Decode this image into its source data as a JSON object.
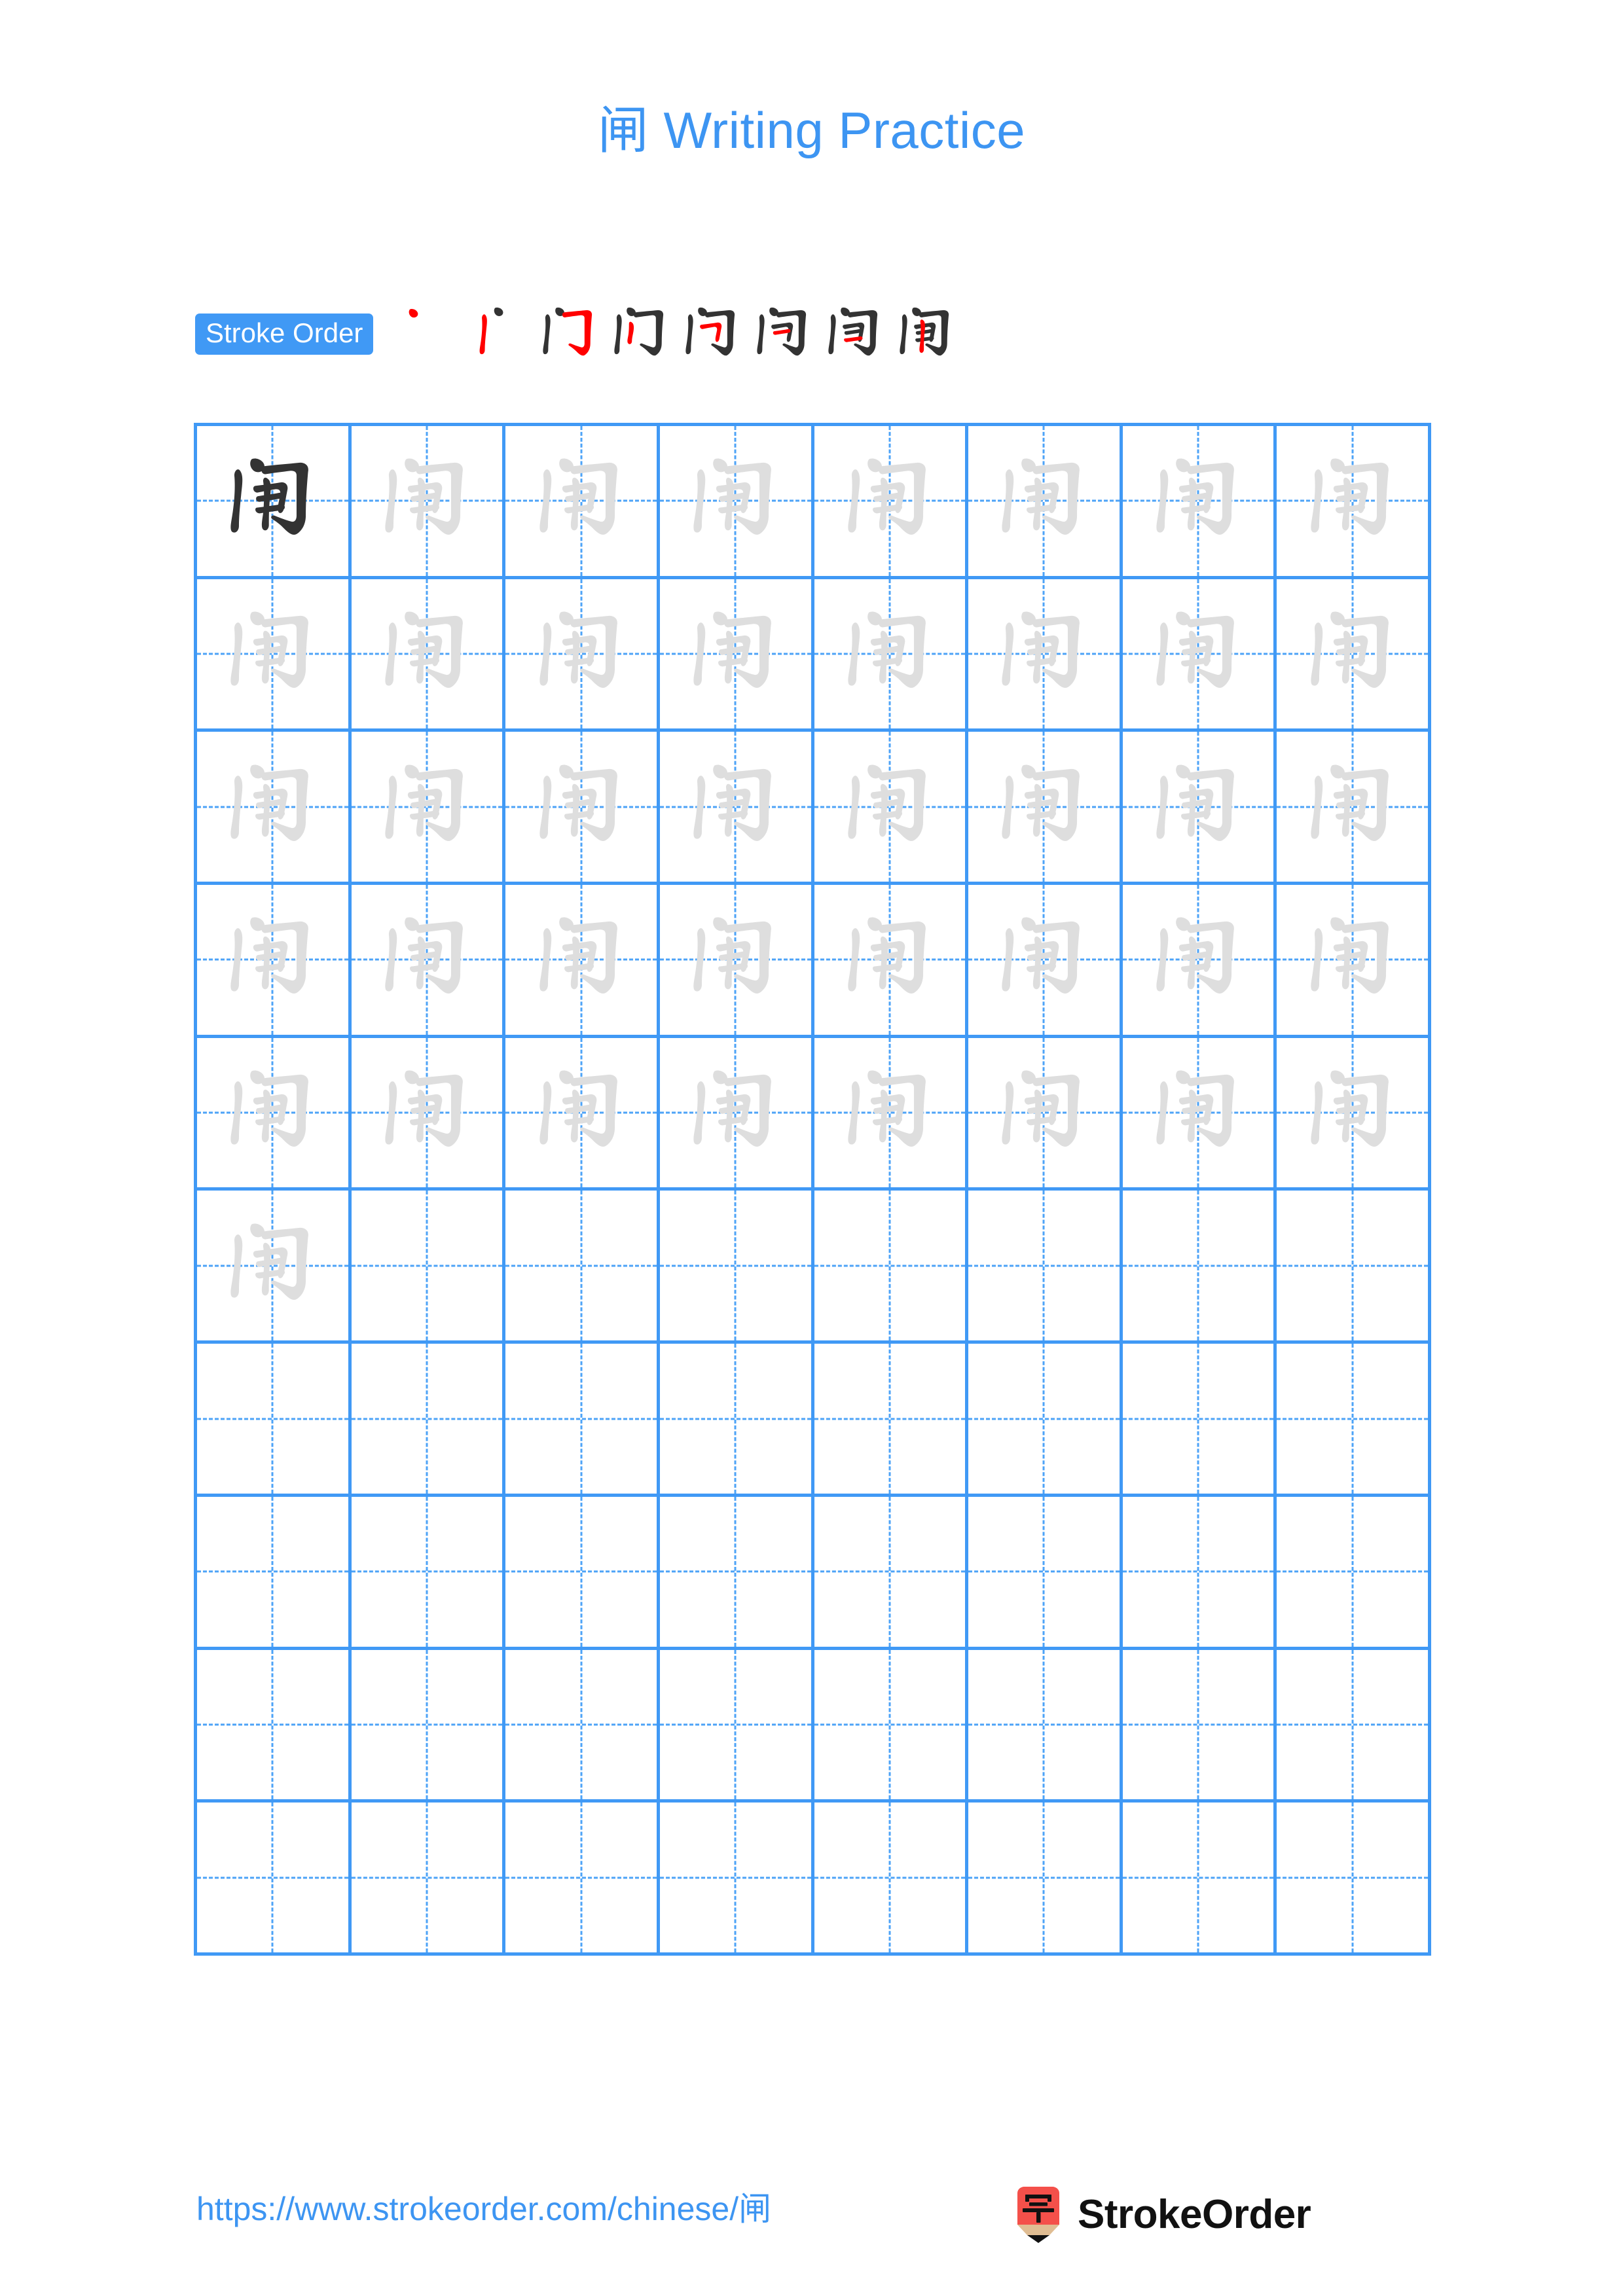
{
  "document": {
    "character": "闸",
    "title_suffix": " Writing Practice",
    "title_full": "闸 Writing Practice",
    "title_color": "#3d95f2",
    "background": "#ffffff"
  },
  "stroke_order": {
    "badge_label": "Stroke Order",
    "badge_bg": "#4099f5",
    "badge_text_color": "#ffffff",
    "new_stroke_color": "#ff0000",
    "done_stroke_color": "#333333",
    "stroke_count": 8,
    "steps": [
      {
        "index": 1,
        "partial": "丶",
        "new_stroke": "dot"
      },
      {
        "index": 2,
        "partial": "丬",
        "new_stroke": "vertical"
      },
      {
        "index": 3,
        "partial": "门",
        "new_stroke": "horizontal-fold-hook"
      },
      {
        "index": 4,
        "partial": "门",
        "new_stroke": "short-vertical"
      },
      {
        "index": 5,
        "partial": "问",
        "new_stroke": "horizontal-fold"
      },
      {
        "index": 6,
        "partial": "问",
        "new_stroke": "horizontal"
      },
      {
        "index": 7,
        "partial": "问",
        "new_stroke": "horizontal"
      },
      {
        "index": 8,
        "partial": "闸",
        "new_stroke": "vertical"
      }
    ]
  },
  "grid": {
    "columns": 8,
    "rows": 10,
    "line_color": "#4099f5",
    "guide_color": "#4da3f7",
    "dark_glyph_color": "#333333",
    "light_glyph_color": "#dedede",
    "dark_cells": 1,
    "traced_cells": 40,
    "blank_cells": 40,
    "cell_character": "闸"
  },
  "footer": {
    "url_text": "https://www.strokeorder.com/chinese/闸",
    "url_color": "#3d95f2",
    "brand_name": "StrokeOrder",
    "logo_character": "字",
    "logo_body_color": "#f4504a",
    "logo_wood_color": "#e0bd93",
    "logo_tip_color": "#111111"
  }
}
